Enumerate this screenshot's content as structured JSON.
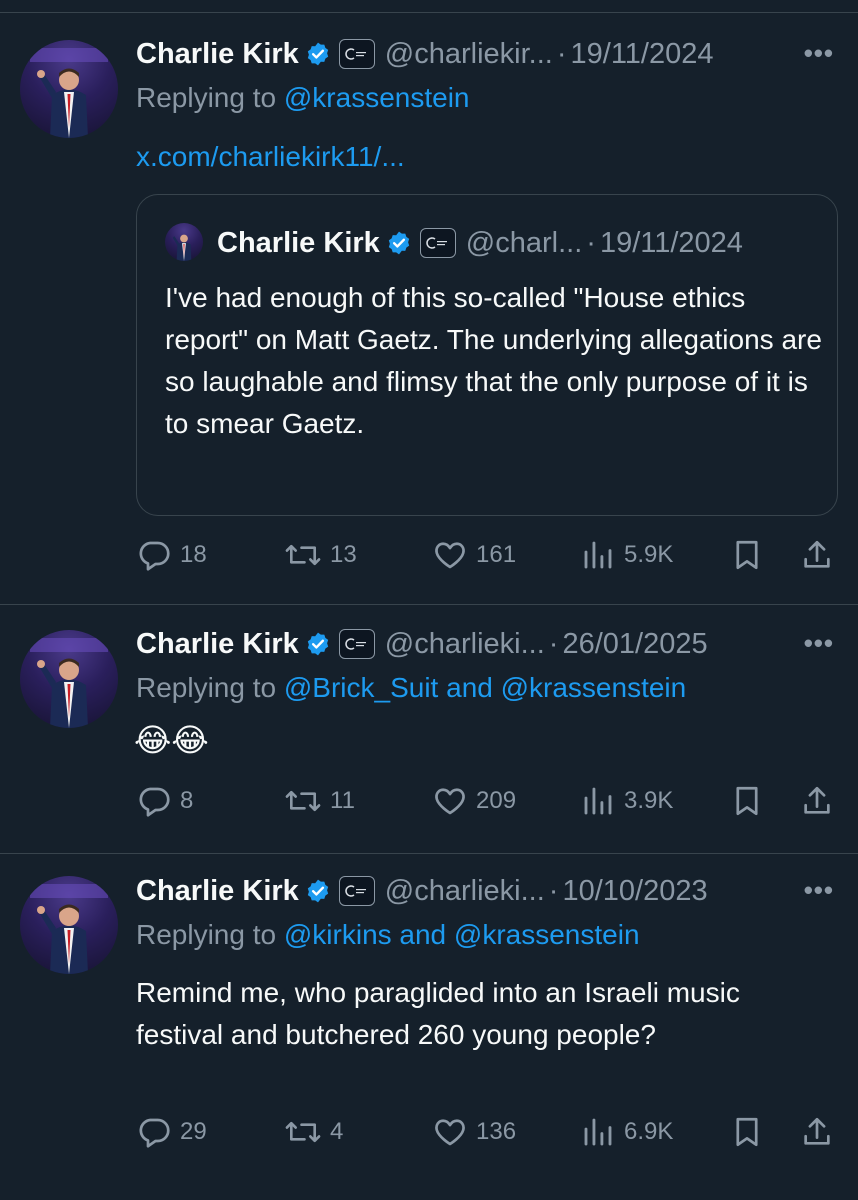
{
  "tweets": [
    {
      "author": "Charlie Kirk",
      "handle": "@charliekir...",
      "separator": "·",
      "date": "19/11/2024",
      "more": "•••",
      "replying_prefix": "Replying to",
      "replying_to": "@krassenstein",
      "link": "x.com/charliekirk11/...",
      "quote": {
        "author": "Charlie Kirk",
        "handle": "@charl...",
        "separator": "·",
        "date": "19/11/2024",
        "text": "I've had enough of this so-called \"House ethics report\" on Matt Gaetz. The underlying allegations are so laughable and flimsy that the only purpose of it is to smear Gaetz."
      },
      "stats": {
        "replies": "18",
        "reposts": "13",
        "likes": "161",
        "views": "5.9K"
      }
    },
    {
      "author": "Charlie Kirk",
      "handle": "@charlieki...",
      "separator": "·",
      "date": "26/01/2025",
      "more": "•••",
      "replying_prefix": "Replying to",
      "replying_to": "@Brick_Suit and @krassenstein",
      "text": "😂😂",
      "stats": {
        "replies": "8",
        "reposts": "11",
        "likes": "209",
        "views": "3.9K"
      }
    },
    {
      "author": "Charlie Kirk",
      "handle": "@charlieki...",
      "separator": "·",
      "date": "10/10/2023",
      "more": "•••",
      "replying_prefix": "Replying to",
      "replying_to": "@kirkins and @krassenstein",
      "text": "Remind me, who paraglided into an Israeli music festival and butchered 260 young people?",
      "stats": {
        "replies": "29",
        "reposts": "4",
        "likes": "136",
        "views": "6.9K"
      }
    }
  ],
  "colors": {
    "background": "#15202b",
    "text": "#f7f9f9",
    "secondary": "#8b98a5",
    "accent": "#1d9bf0",
    "border": "#38444d"
  },
  "icons": [
    "verified-badge-icon",
    "affiliate-badge-icon",
    "more-icon",
    "reply-icon",
    "repost-icon",
    "like-icon",
    "views-icon",
    "bookmark-icon",
    "share-icon"
  ]
}
